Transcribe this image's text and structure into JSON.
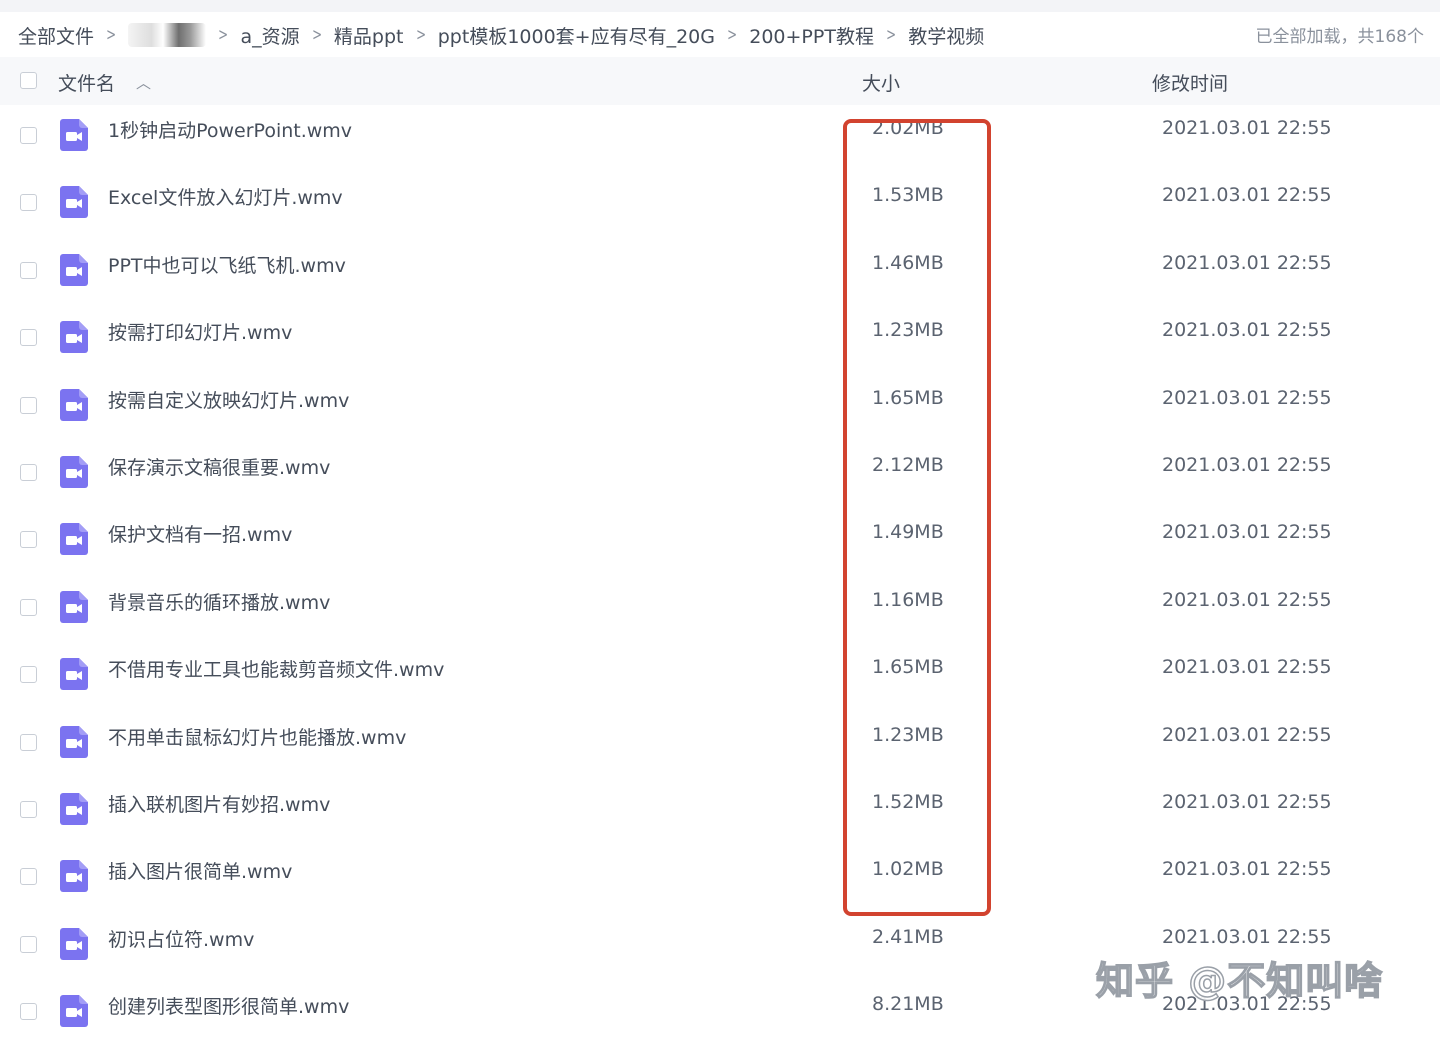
{
  "breadcrumb": {
    "items": [
      "全部文件",
      "",
      "a_资源",
      "精品ppt",
      "ppt模板1000套+应有尽有_20G",
      "200+PPT教程",
      "教学视频"
    ],
    "separator": ">"
  },
  "file_count": "已全部加载，共168个",
  "columns": {
    "name": "文件名",
    "size": "大小",
    "modified": "修改时间"
  },
  "icons": {
    "sort": "chevron-up-icon",
    "file": "video-file-icon"
  },
  "colors": {
    "file_icon": "#7b73f0",
    "highlight": "#d2432f"
  },
  "files": [
    {
      "name": "1秒钟启动PowerPoint.wmv",
      "size": "2.02MB",
      "modified": "2021.03.01 22:55"
    },
    {
      "name": "Excel文件放入幻灯片.wmv",
      "size": "1.53MB",
      "modified": "2021.03.01 22:55"
    },
    {
      "name": "PPT中也可以飞纸飞机.wmv",
      "size": "1.46MB",
      "modified": "2021.03.01 22:55"
    },
    {
      "name": "按需打印幻灯片.wmv",
      "size": "1.23MB",
      "modified": "2021.03.01 22:55"
    },
    {
      "name": "按需自定义放映幻灯片.wmv",
      "size": "1.65MB",
      "modified": "2021.03.01 22:55"
    },
    {
      "name": "保存演示文稿很重要.wmv",
      "size": "2.12MB",
      "modified": "2021.03.01 22:55"
    },
    {
      "name": "保护文档有一招.wmv",
      "size": "1.49MB",
      "modified": "2021.03.01 22:55"
    },
    {
      "name": "背景音乐的循环播放.wmv",
      "size": "1.16MB",
      "modified": "2021.03.01 22:55"
    },
    {
      "name": "不借用专业工具也能裁剪音频文件.wmv",
      "size": "1.65MB",
      "modified": "2021.03.01 22:55"
    },
    {
      "name": "不用单击鼠标幻灯片也能播放.wmv",
      "size": "1.23MB",
      "modified": "2021.03.01 22:55"
    },
    {
      "name": "插入联机图片有妙招.wmv",
      "size": "1.52MB",
      "modified": "2021.03.01 22:55"
    },
    {
      "name": "插入图片很简单.wmv",
      "size": "1.02MB",
      "modified": "2021.03.01 22:55"
    },
    {
      "name": "初识占位符.wmv",
      "size": "2.41MB",
      "modified": "2021.03.01 22:55"
    },
    {
      "name": "创建列表型图形很简单.wmv",
      "size": "8.21MB",
      "modified": "2021.03.01 22:55"
    }
  ],
  "watermark": "知乎 @不知叫啥"
}
